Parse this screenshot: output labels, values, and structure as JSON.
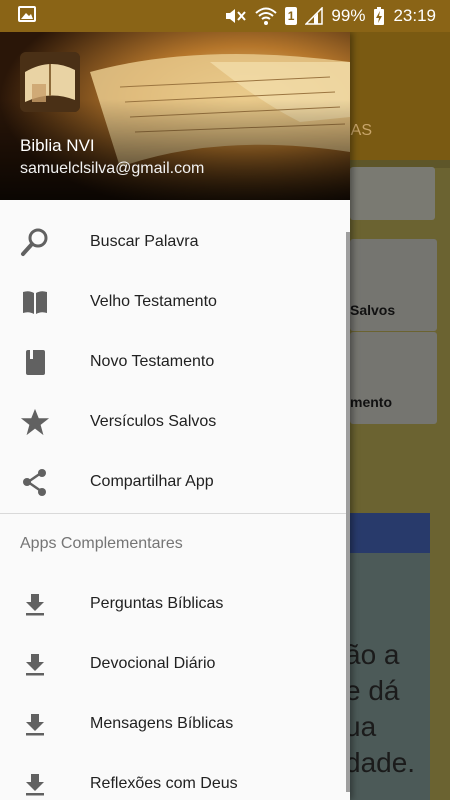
{
  "status_bar": {
    "battery": "99%",
    "time": "23:19",
    "sim_slot": "1"
  },
  "drawer": {
    "header": {
      "title": "Biblia NVI",
      "email": "samuelclsilva@gmail.com"
    },
    "menu": [
      {
        "label": "Buscar Palavra",
        "icon": "search-icon"
      },
      {
        "label": "Velho Testamento",
        "icon": "open-book-icon"
      },
      {
        "label": "Novo Testamento",
        "icon": "closed-book-icon"
      },
      {
        "label": "Versículos Salvos",
        "icon": "star-icon"
      },
      {
        "label": "Compartilhar App",
        "icon": "share-icon"
      }
    ],
    "section_title": "Apps Complementares",
    "apps": [
      {
        "label": "Perguntas Bíblicas",
        "icon": "download-icon"
      },
      {
        "label": "Devocional Diário",
        "icon": "download-icon"
      },
      {
        "label": "Mensagens Bíblicas",
        "icon": "download-icon"
      },
      {
        "label": "Reflexões com Deus",
        "icon": "download-icon"
      }
    ]
  },
  "background": {
    "tab_fragment": "AS",
    "card1_fragment": "Salvos",
    "card2_fragment": "mento",
    "panel_lines": [
      "ão a",
      "e dá",
      "ua",
      "dade."
    ]
  },
  "colors": {
    "status_bar": "#8a6416",
    "drawer_bg": "#fafafa",
    "text_primary": "#212121",
    "text_secondary": "#757575",
    "icon": "#616161"
  }
}
